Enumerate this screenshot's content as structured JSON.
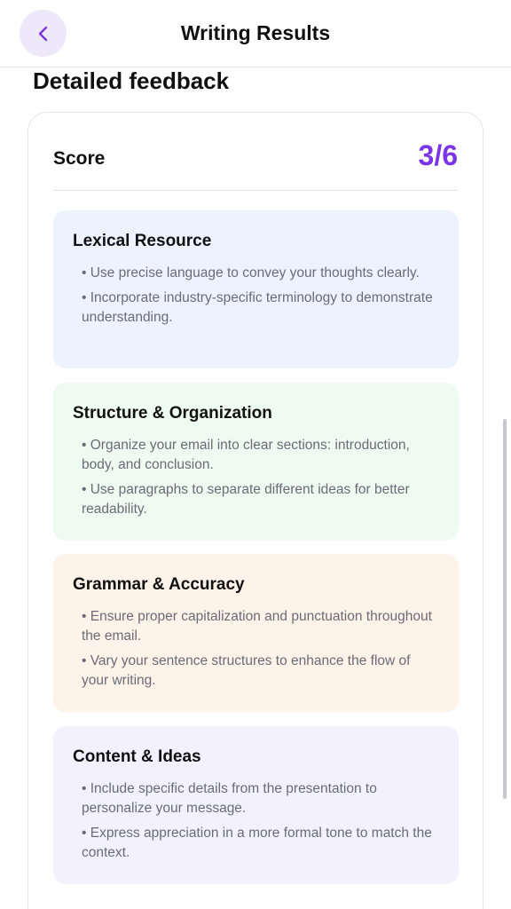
{
  "header": {
    "title": "Writing Results",
    "back_icon": "chevron-left-icon",
    "accent": "#7b35e6"
  },
  "main": {
    "section_title": "Detailed feedback",
    "score": {
      "label": "Score",
      "value": "3/6"
    },
    "feedback": [
      {
        "title": "Lexical Resource",
        "bg": "#edf3fe",
        "points": [
          "• Use precise language to convey your thoughts clearly.",
          "• Incorporate industry-specific terminology to demonstrate understanding."
        ]
      },
      {
        "title": "Structure & Organization",
        "bg": "#edfbf1",
        "points": [
          "• Organize your email into clear sections: introduction, body, and conclusion.",
          "• Use paragraphs to separate different ideas for better readability."
        ]
      },
      {
        "title": "Grammar & Accuracy",
        "bg": "#fef3e8",
        "points": [
          "• Ensure proper capitalization and punctuation throughout the email.",
          "• Vary your sentence structures to enhance the flow of your writing."
        ]
      },
      {
        "title": "Content & Ideas",
        "bg": "#f3f1fe",
        "points": [
          "• Include specific details from the presentation to personalize your message.",
          "• Express appreciation in a more formal tone to match the context."
        ]
      }
    ]
  }
}
